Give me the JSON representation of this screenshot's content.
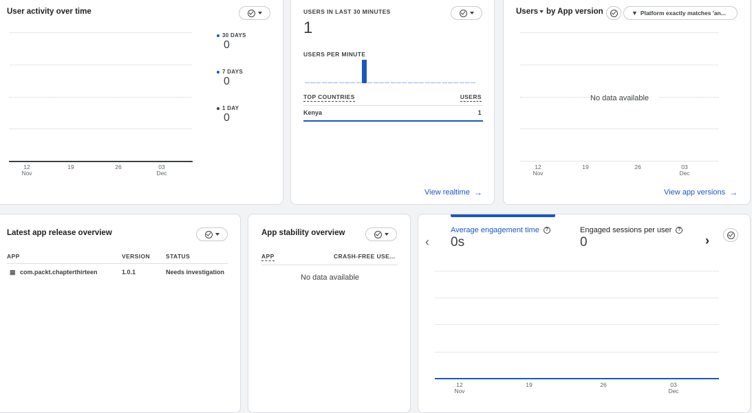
{
  "activity": {
    "title": "User activity over time",
    "legend": [
      {
        "label": "30 DAYS",
        "value": "0",
        "color": "#1a56c4"
      },
      {
        "label": "7 DAYS",
        "value": "0",
        "color": "#1a56c4"
      },
      {
        "label": "1 DAY",
        "value": "0",
        "color": "#3c4043"
      }
    ],
    "ticks": [
      {
        "day": "12",
        "month": "Nov"
      },
      {
        "day": "19",
        "month": ""
      },
      {
        "day": "26",
        "month": ""
      },
      {
        "day": "03",
        "month": "Dec"
      }
    ]
  },
  "realtime": {
    "heading": "USERS IN LAST 30 MINUTES",
    "count": "1",
    "per_minute_label": "USERS PER MINUTE",
    "per_minute": [
      0,
      0,
      0,
      0,
      0,
      0,
      0,
      0,
      0,
      0,
      1,
      0,
      0,
      0,
      0,
      0,
      0,
      0,
      0,
      0,
      0,
      0,
      0,
      0,
      0,
      0,
      0,
      0,
      0,
      0
    ],
    "table_col_left": "TOP COUNTRIES",
    "table_col_right": "USERS",
    "row_country": "Kenya",
    "row_users": "1",
    "link": "View realtime",
    "accent": "#1a56c4"
  },
  "versions": {
    "title_prefix": "Users",
    "title_suffix": "by App version",
    "filter": "Platform exactly matches 'an...",
    "empty": "No data available",
    "ticks": [
      {
        "day": "12",
        "month": "Nov"
      },
      {
        "day": "19",
        "month": ""
      },
      {
        "day": "26",
        "month": ""
      },
      {
        "day": "03",
        "month": "Dec"
      }
    ],
    "link": "View app versions"
  },
  "release": {
    "title": "Latest app release overview",
    "col_app": "APP",
    "col_version": "VERSION",
    "col_status": "STATUS",
    "row_app": "com.packt.chapterthirteen",
    "row_version": "1.0.1",
    "row_status": "Needs investigation"
  },
  "stability": {
    "title": "App stability overview",
    "col_app": "APP",
    "col_crash": "CRASH-FREE USE...",
    "empty": "No data available"
  },
  "engagement": {
    "metric1_label": "Average engagement time",
    "metric1_value": "0s",
    "metric2_label": "Engaged sessions per user",
    "metric2_value": "0",
    "ticks": [
      {
        "day": "12",
        "month": "Nov"
      },
      {
        "day": "19",
        "month": ""
      },
      {
        "day": "26",
        "month": ""
      },
      {
        "day": "03",
        "month": "Dec"
      }
    ]
  }
}
